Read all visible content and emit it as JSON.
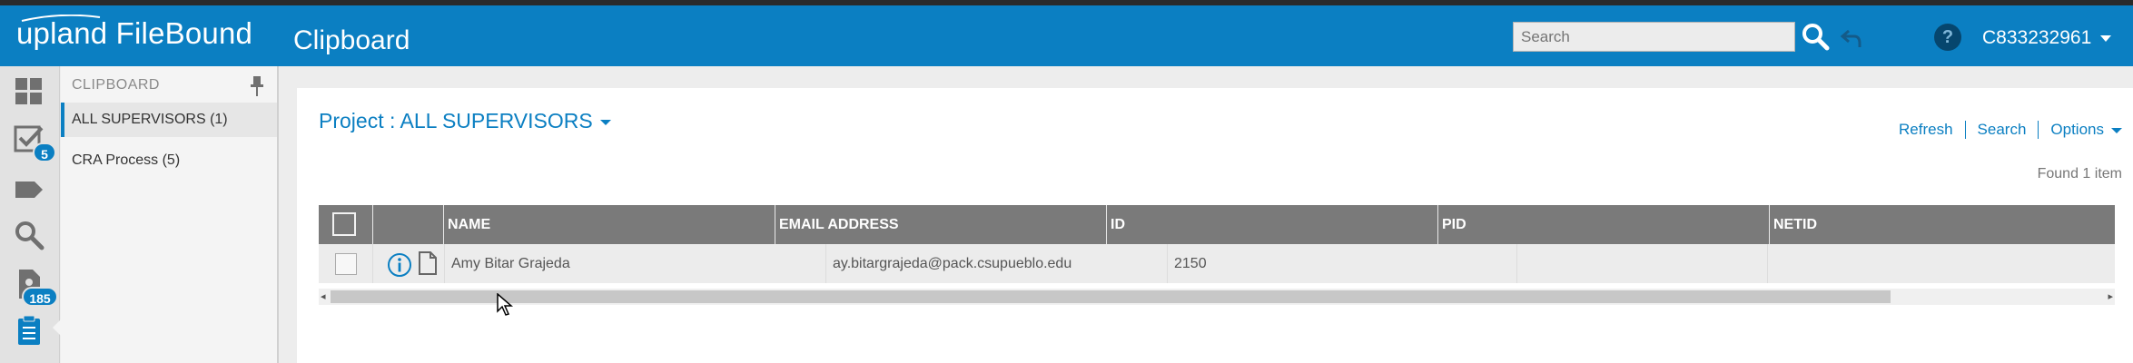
{
  "app": {
    "logo_text": "upland FileBound",
    "page_title": "Clipboard"
  },
  "header": {
    "search_placeholder": "Search",
    "help_label": "?",
    "user_name": "C833232961"
  },
  "leftrail": {
    "items": [
      {
        "icon": "dashboard-icon"
      },
      {
        "icon": "tasks-check-icon",
        "badge": "5"
      },
      {
        "icon": "tag-icon"
      },
      {
        "icon": "search-icon"
      },
      {
        "icon": "document-key-icon",
        "badge": "185"
      },
      {
        "icon": "clipboard-icon"
      }
    ]
  },
  "panel": {
    "heading": "CLIPBOARD",
    "items": [
      {
        "label": "ALL SUPERVISORS (1)"
      },
      {
        "label": "CRA Process (5)"
      }
    ]
  },
  "main": {
    "project_label": "Project : ALL SUPERVISORS",
    "actions": [
      "Refresh",
      "Search",
      "Options"
    ],
    "found_text": "Found 1 item",
    "table": {
      "columns": [
        "NAME",
        "EMAIL ADDRESS",
        "ID",
        "PID",
        "NETID"
      ],
      "rows": [
        {
          "name": "Amy Bitar Grajeda",
          "email": "ay.bitargrajeda@pack.csupueblo.edu",
          "id": "2150",
          "pid": "",
          "netid": ""
        }
      ]
    }
  },
  "colors": {
    "brand_blue": "#0b7fc2",
    "header_grey": "#7a7a7a"
  }
}
